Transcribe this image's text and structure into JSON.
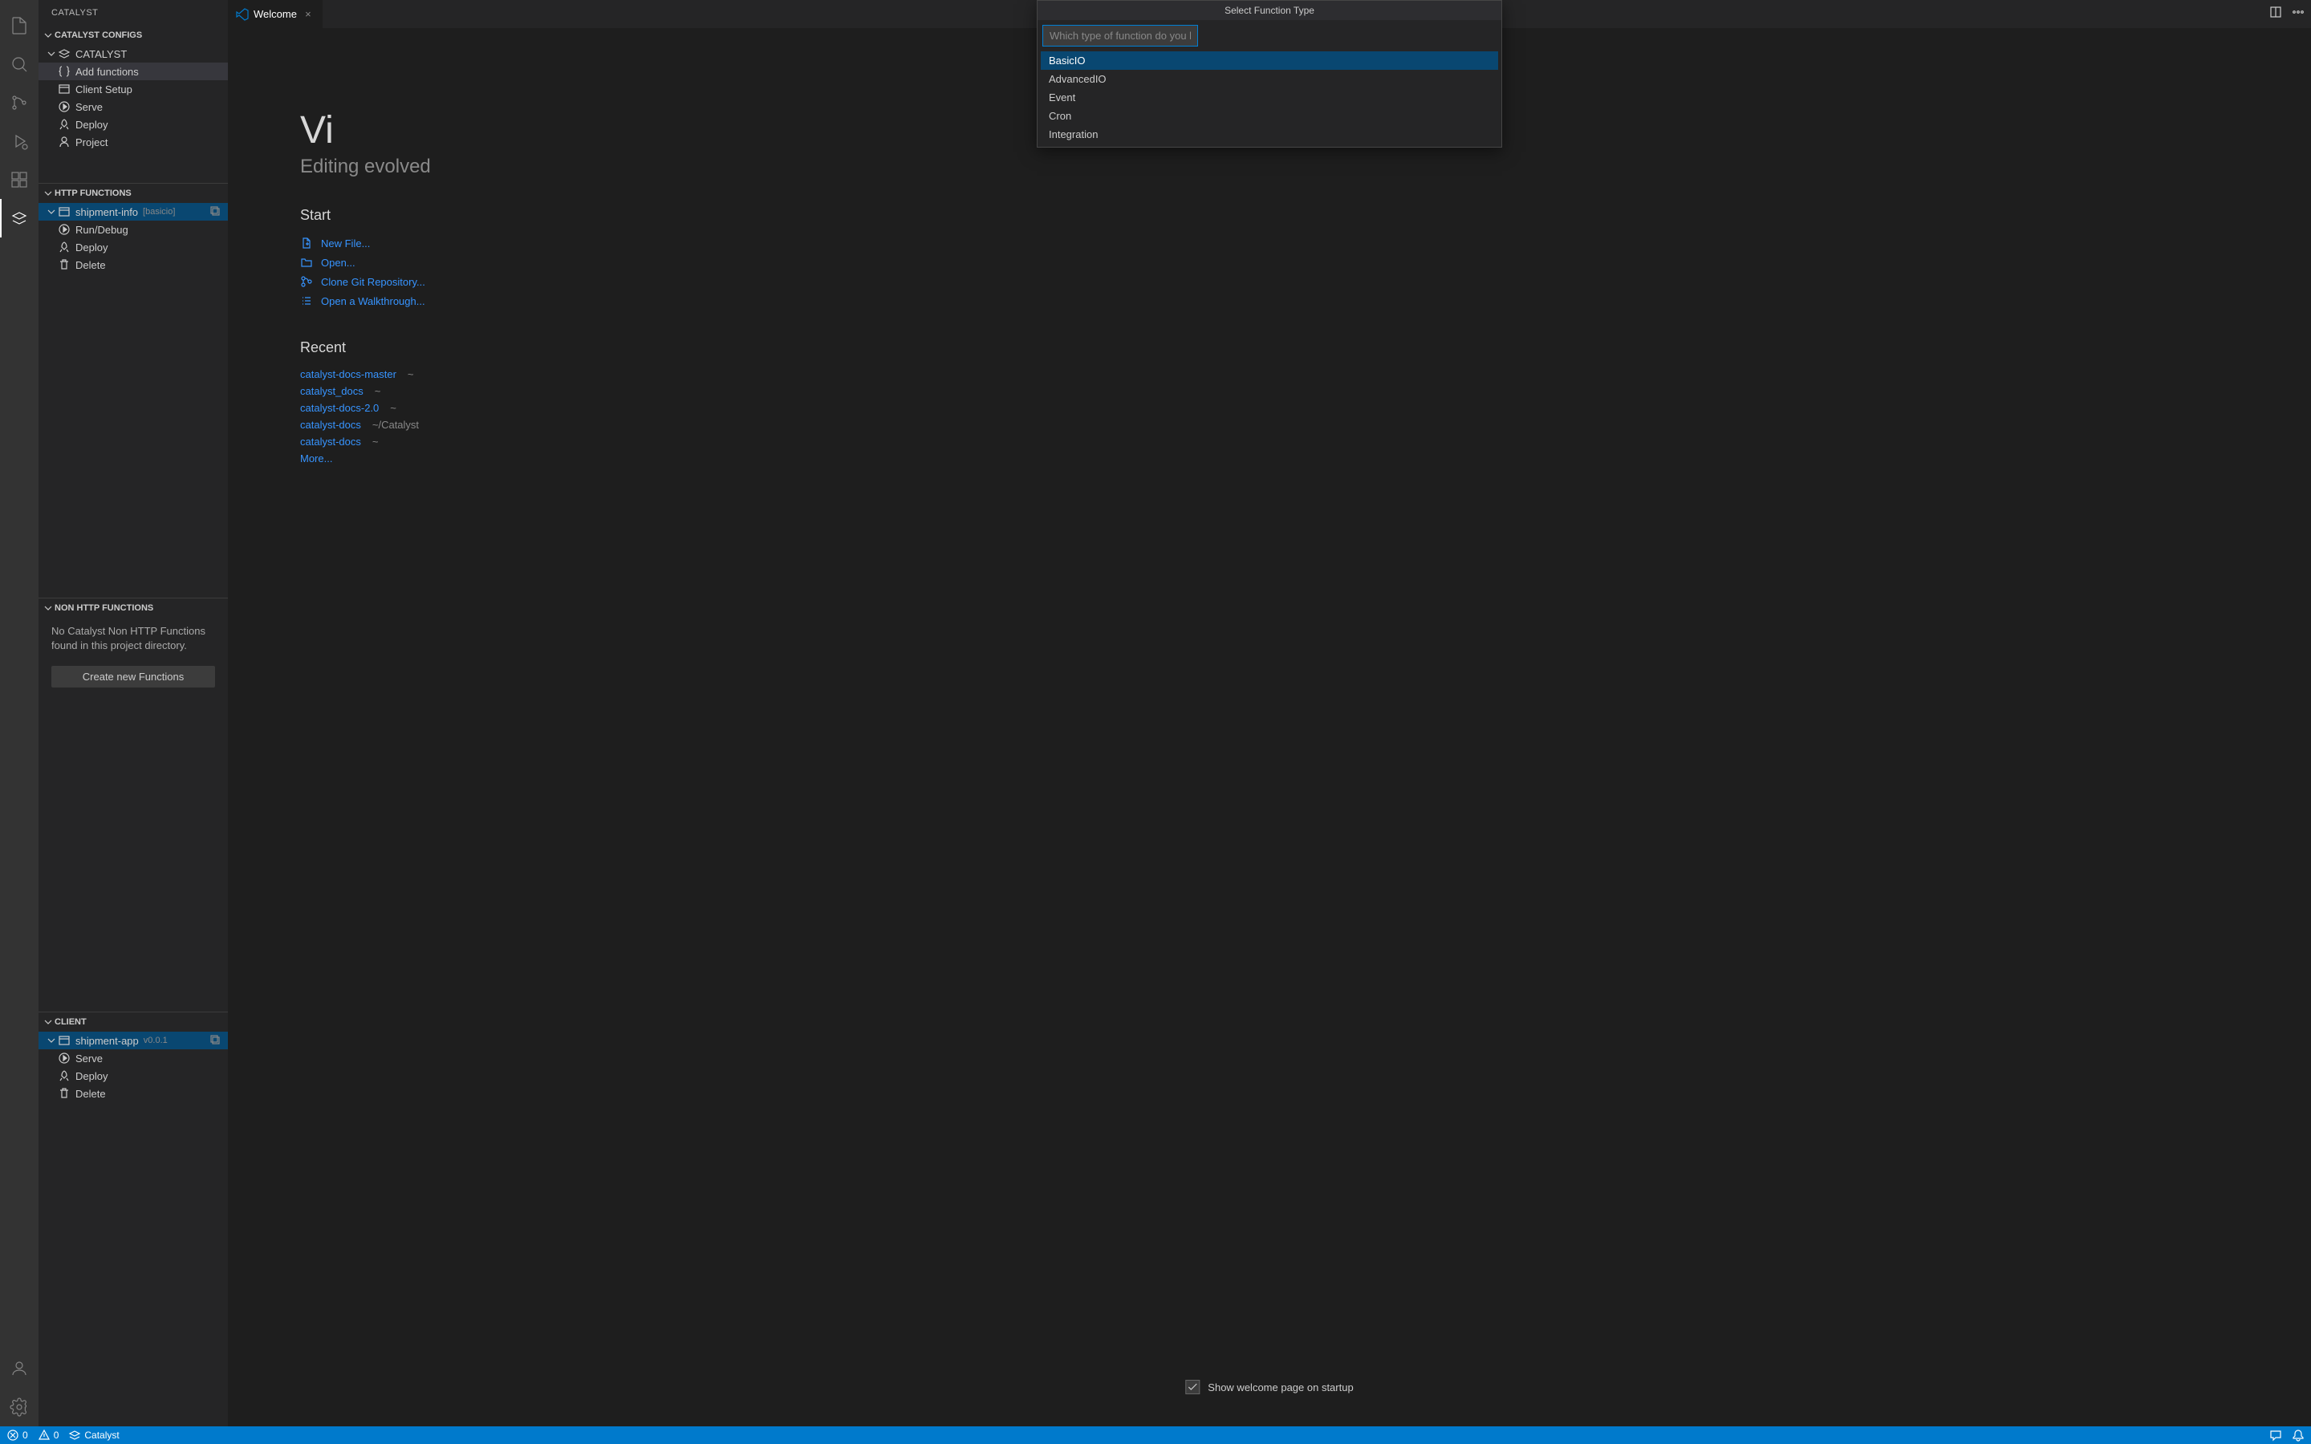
{
  "sidebar": {
    "title": "CATALYST",
    "configs": {
      "header": "CATALYST CONFIGS",
      "root": "CATALYST",
      "items": [
        {
          "label": "Add functions"
        },
        {
          "label": "Client Setup"
        },
        {
          "label": "Serve"
        },
        {
          "label": "Deploy"
        },
        {
          "label": "Project"
        }
      ]
    },
    "http": {
      "header": "HTTP FUNCTIONS",
      "item_name": "shipment-info",
      "item_tag": "[basicio]",
      "children": [
        {
          "label": "Run/Debug"
        },
        {
          "label": "Deploy"
        },
        {
          "label": "Delete"
        }
      ]
    },
    "nonhttp": {
      "header": "NON HTTP FUNCTIONS",
      "empty": "No Catalyst Non HTTP Functions found in this project directory.",
      "create": "Create new Functions"
    },
    "client": {
      "header": "CLIENT",
      "item_name": "shipment-app",
      "item_tag": "v0.0.1",
      "children": [
        {
          "label": "Serve"
        },
        {
          "label": "Deploy"
        },
        {
          "label": "Delete"
        }
      ]
    }
  },
  "tab": {
    "label": "Welcome"
  },
  "welcome": {
    "title_part": "Vi",
    "subtitle": "Editing evolved",
    "start_header": "Start",
    "start_links": [
      "New File...",
      "Open...",
      "Clone Git Repository...",
      "Open a Walkthrough..."
    ],
    "recent_header": "Recent",
    "recent": [
      {
        "name": "catalyst-docs-master",
        "path": "~"
      },
      {
        "name": "catalyst_docs",
        "path": "~"
      },
      {
        "name": "catalyst-docs-2.0",
        "path": "~"
      },
      {
        "name": "catalyst-docs",
        "path": "~/Catalyst"
      },
      {
        "name": "catalyst-docs",
        "path": "~"
      }
    ],
    "more": "More...",
    "startup_label": "Show welcome page on startup"
  },
  "quickpick": {
    "title": "Select Function Type",
    "placeholder": "Which type of function do you like to create?",
    "items": [
      "BasicIO",
      "AdvancedIO",
      "Event",
      "Cron",
      "Integration"
    ]
  },
  "status": {
    "errors": "0",
    "warnings": "0",
    "tool": "Catalyst"
  },
  "colors": {
    "accent": "#007acc",
    "link": "#3794ff",
    "bg": "#1e1e1e",
    "sidebar_bg": "#252526",
    "activitybar_bg": "#333333"
  }
}
